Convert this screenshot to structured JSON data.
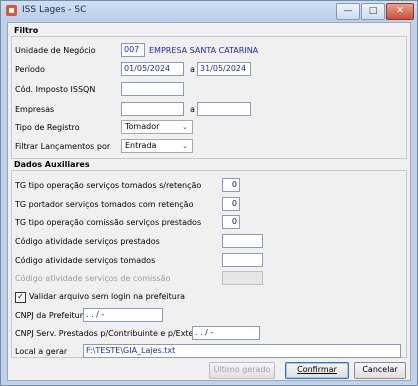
{
  "window": {
    "title": "ISS Lages - SC",
    "minimize_glyph": "—",
    "maximize_glyph": "□",
    "close_glyph": "✕"
  },
  "filtro": {
    "title": "Filtro",
    "unidade_label": "Unidade de Negócio",
    "unidade_code": "007",
    "unidade_name": "EMPRESA SANTA CATARINA",
    "periodo_label": "Período",
    "periodo_start": "01/05/2024",
    "periodo_sep": "a",
    "periodo_end": "31/05/2024",
    "cod_imposto_label": "Cód. Imposto ISSQN",
    "cod_imposto_value": "",
    "empresas_label": "Empresas",
    "empresas_start": "",
    "empresas_sep": "a",
    "empresas_end": "",
    "tipo_registro_label": "Tipo de Registro",
    "tipo_registro_value": "Tomador",
    "filtrar_label": "Filtrar Lançamentos por",
    "filtrar_value": "Entrada"
  },
  "aux": {
    "title": "Dados Auxiliares",
    "tg_tomados_label": "TG tipo operação serviços tomados s/retenção",
    "tg_tomados_value": "0",
    "tg_portador_label": "TG portador serviços tomados com retenção",
    "tg_portador_value": "0",
    "tg_comissao_label": "TG tipo operação comissão serviços prestados",
    "tg_comissao_value": "0",
    "cod_prestados_label": "Código atividade serviços prestados",
    "cod_prestados_value": "",
    "cod_tomados_label": "Código atividade serviços tomados",
    "cod_tomados_value": "",
    "cod_comissao_label": "Código atividade serviços de comissão",
    "cod_comissao_value": "",
    "validar_label": "Validar arquivo sem login na prefeitura",
    "validar_checked": "✓",
    "cnpj_prefeitura_label": "CNPJ da Prefeitura",
    "cnpj_prefeitura_value": "  .   .   /   -",
    "cnpj_serv_label": "CNPJ Serv. Prestados p/Contribuinte e p/Exterior",
    "cnpj_serv_value": "  .   .   /   -",
    "local_label": "Local a gerar",
    "local_value": "F:\\TESTE\\GIA_Lajes.txt"
  },
  "buttons": {
    "ultimo": "Último gerado",
    "confirmar": "Confirmar",
    "cancelar": "Cancelar"
  },
  "icons": {
    "dropdown": "⌄"
  }
}
